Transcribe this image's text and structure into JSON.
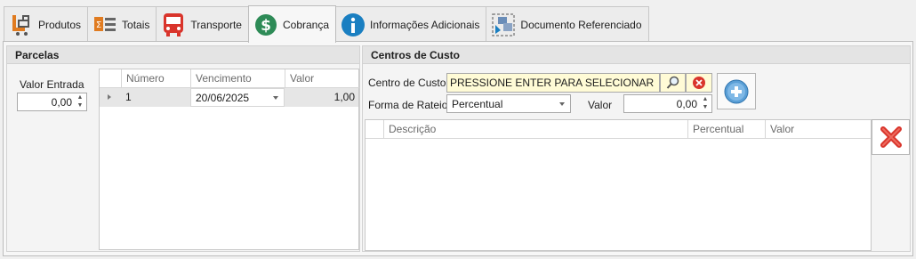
{
  "tabs": [
    {
      "label": "Produtos",
      "icon": "products-icon"
    },
    {
      "label": "Totais",
      "icon": "sum-icon"
    },
    {
      "label": "Transporte",
      "icon": "bus-icon"
    },
    {
      "label": "Cobrança",
      "icon": "dollar-icon"
    },
    {
      "label": "Informações Adicionais",
      "icon": "info-icon"
    },
    {
      "label": "Documento Referenciado",
      "icon": "document-reference-icon"
    }
  ],
  "parcelas": {
    "title": "Parcelas",
    "valor_entrada_label": "Valor Entrada",
    "valor_entrada": "0,00",
    "columns": [
      "Número",
      "Vencimento",
      "Valor"
    ],
    "rows": [
      {
        "numero": "1",
        "vencimento": "20/06/2025",
        "valor": "1,00"
      }
    ]
  },
  "centros": {
    "title": "Centros de Custo",
    "centro_label": "Centro de Custo",
    "centro_value": "PRESSIONE ENTER PARA SELECIONAR",
    "forma_label": "Forma de Rateio",
    "forma_value": "Percentual",
    "valor_label": "Valor",
    "valor_value": "0,00",
    "columns": [
      "Descrição",
      "Percentual",
      "Valor"
    ]
  },
  "colors": {
    "accent_green": "#2e8b57",
    "accent_blue": "#1a7fc1",
    "danger_red": "#d9342b",
    "field_yellow": "#fffbd6"
  }
}
